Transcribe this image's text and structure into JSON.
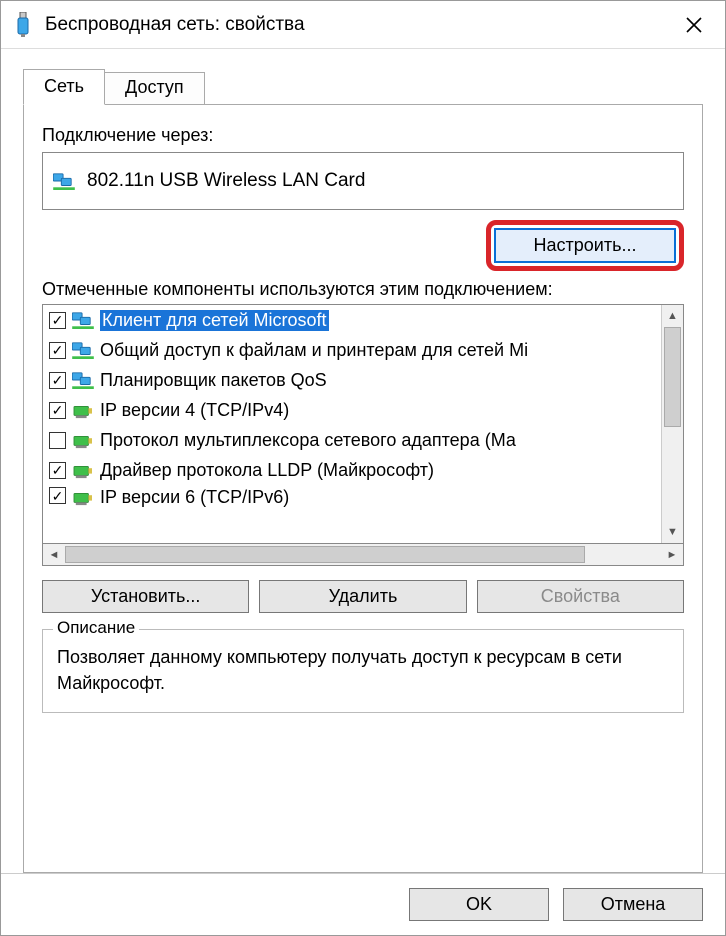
{
  "titlebar": {
    "title": "Беспроводная сеть: свойства"
  },
  "tabs": [
    {
      "label": "Сеть",
      "active": true
    },
    {
      "label": "Доступ",
      "active": false
    }
  ],
  "connection": {
    "label": "Подключение через:",
    "adapter": "802.11n USB Wireless LAN Card",
    "configure_label": "Настроить..."
  },
  "components": {
    "label": "Отмеченные компоненты используются этим подключением:",
    "items": [
      {
        "checked": true,
        "icon": "monitor",
        "label": "Клиент для сетей Microsoft",
        "selected": true
      },
      {
        "checked": true,
        "icon": "monitor",
        "label": "Общий доступ к файлам и принтерам для сетей Mi"
      },
      {
        "checked": true,
        "icon": "monitor",
        "label": "Планировщик пакетов QoS"
      },
      {
        "checked": true,
        "icon": "nic",
        "label": "IP версии 4 (TCP/IPv4)"
      },
      {
        "checked": false,
        "icon": "nic",
        "label": "Протокол мультиплексора сетевого адаптера (Ма"
      },
      {
        "checked": true,
        "icon": "nic",
        "label": "Драйвер протокола LLDP (Майкрософт)"
      },
      {
        "checked": true,
        "icon": "nic",
        "label": "IP версии 6 (TCP/IPv6)"
      }
    ]
  },
  "buttons": {
    "install": "Установить...",
    "uninstall": "Удалить",
    "properties": "Свойства"
  },
  "description": {
    "legend": "Описание",
    "text": "Позволяет данному компьютеру получать доступ к ресурсам в сети Майкрософт."
  },
  "footer": {
    "ok": "OK",
    "cancel": "Отмена"
  }
}
